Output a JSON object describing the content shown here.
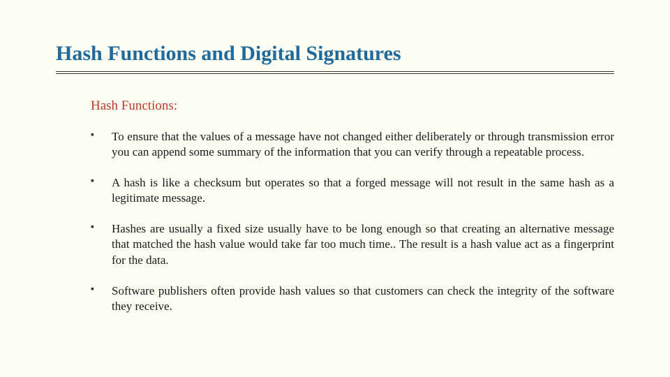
{
  "title": "Hash Functions and Digital Signatures",
  "subhead": "Hash Functions:",
  "bullets": [
    "To ensure that the values of a message have not changed either deliberately or through transmission error you can append some summary of the information that you can verify through a repeatable process.",
    "A hash is like a checksum but operates so that a forged message will not result in the same hash as a legitimate message.",
    "Hashes are usually a fixed size usually have to be long enough so that creating an alternative message that matched the hash value would take far too much time.. The result is a hash value act as a fingerprint for the data.",
    "Software publishers often provide hash values so that customers can check the integrity of the software they receive."
  ]
}
